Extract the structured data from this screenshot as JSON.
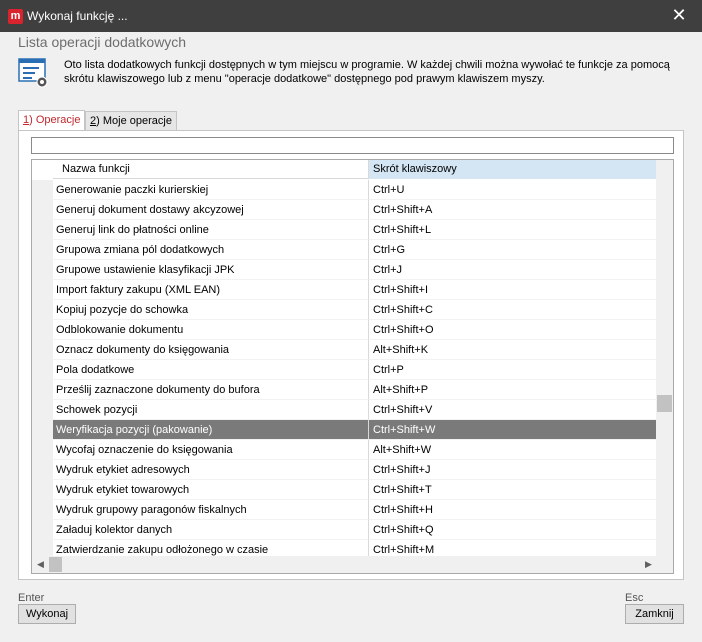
{
  "window": {
    "app_icon_letter": "m",
    "title": "Wykonaj funkcję ...",
    "close_glyph": "✕"
  },
  "dialog": {
    "heading": "Lista operacji dodatkowych",
    "description": "Oto lista dodatkowych funkcji dostępnych w tym miejscu w programie. W każdej chwili można wywołać te funkcje za pomocą skrótu klawiszowego lub z menu \"operacje dodatkowe\" dostępnego pod prawym klawiszem myszy."
  },
  "tabs": [
    {
      "key": "1",
      "label": ") Operacje",
      "active": true
    },
    {
      "key": "2",
      "label": ") Moje operacje",
      "active": false
    }
  ],
  "filter": {
    "value": "",
    "placeholder": ""
  },
  "table": {
    "columns": [
      "Nazwa funkcji",
      "Skrót klawiszowy"
    ],
    "rows": [
      {
        "name": "Generowanie paczki kurierskiej",
        "shortcut": "Ctrl+U"
      },
      {
        "name": "Generuj dokument dostawy akcyzowej",
        "shortcut": "Ctrl+Shift+A"
      },
      {
        "name": "Generuj link do płatności online",
        "shortcut": "Ctrl+Shift+L"
      },
      {
        "name": "Grupowa zmiana pól dodatkowych",
        "shortcut": "Ctrl+G"
      },
      {
        "name": "Grupowe ustawienie klasyfikacji JPK",
        "shortcut": "Ctrl+J"
      },
      {
        "name": "Import faktury zakupu (XML EAN)",
        "shortcut": "Ctrl+Shift+I"
      },
      {
        "name": "Kopiuj pozycje do schowka",
        "shortcut": "Ctrl+Shift+C"
      },
      {
        "name": "Odblokowanie dokumentu",
        "shortcut": "Ctrl+Shift+O"
      },
      {
        "name": "Oznacz dokumenty do księgowania",
        "shortcut": "Alt+Shift+K"
      },
      {
        "name": "Pola dodatkowe",
        "shortcut": "Ctrl+P"
      },
      {
        "name": "Prześlij zaznaczone dokumenty do bufora",
        "shortcut": "Alt+Shift+P"
      },
      {
        "name": "Schowek pozycji",
        "shortcut": "Ctrl+Shift+V"
      },
      {
        "name": "Weryfikacja pozycji (pakowanie)",
        "shortcut": "Ctrl+Shift+W",
        "selected": true
      },
      {
        "name": "Wycofaj oznaczenie do księgowania",
        "shortcut": "Alt+Shift+W"
      },
      {
        "name": "Wydruk etykiet adresowych",
        "shortcut": "Ctrl+Shift+J"
      },
      {
        "name": "Wydruk etykiet towarowych",
        "shortcut": "Ctrl+Shift+T"
      },
      {
        "name": "Wydruk grupowy paragonów fiskalnych",
        "shortcut": "Ctrl+Shift+H"
      },
      {
        "name": "Załaduj kolektor danych",
        "shortcut": "Ctrl+Shift+Q"
      },
      {
        "name": "Zatwierdzanie zakupu odłożonego w czasie",
        "shortcut": "Ctrl+Shift+M"
      }
    ]
  },
  "footer": {
    "execute_hint": "Enter",
    "execute_label": "Wykonaj",
    "close_hint": "Esc",
    "close_label": "Zamknij"
  },
  "colors": {
    "titlebar": "#3f3f3f",
    "brand": "#d9232d",
    "active_tab_text": "#c0292e",
    "selected_row": "#7a7a7a",
    "sorted_header": "#d4e6f4"
  }
}
